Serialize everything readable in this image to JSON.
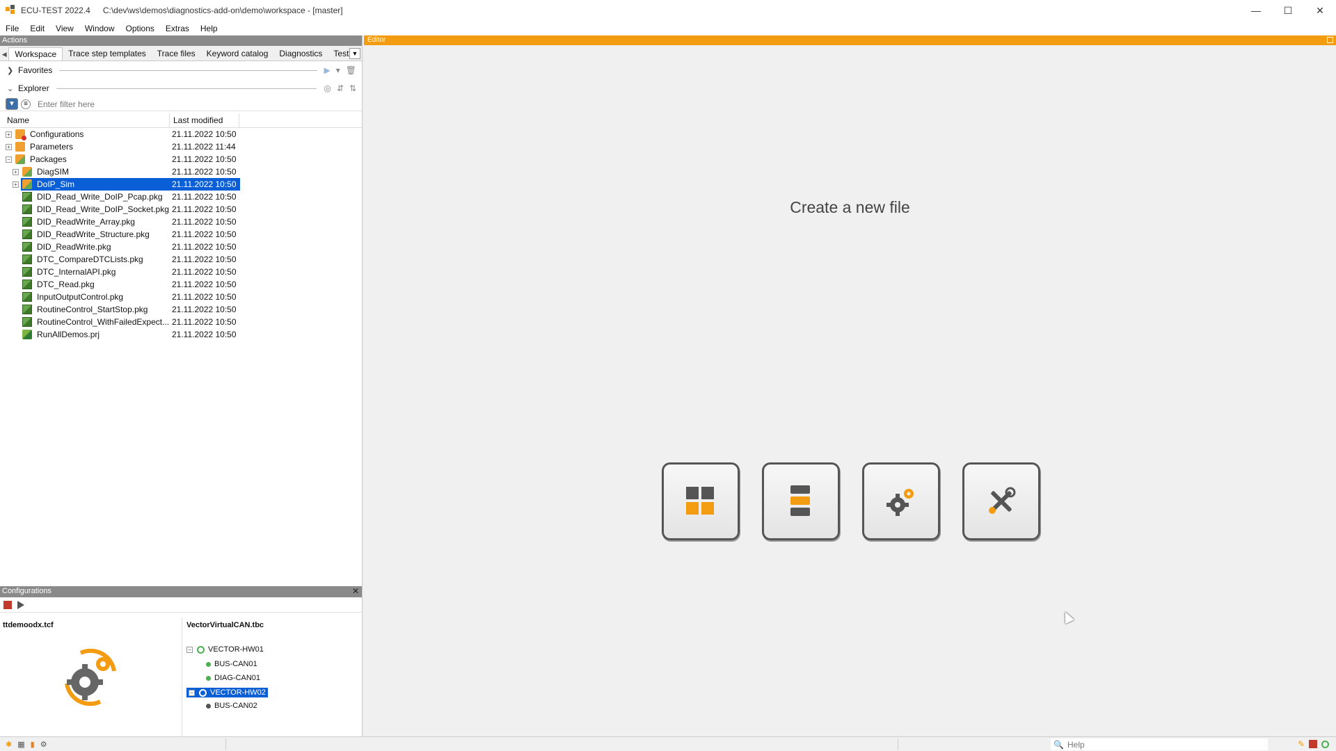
{
  "window": {
    "app_name": "ECU-TEST 2022.4",
    "path": "C:\\dev\\ws\\demos\\diagnostics-add-on\\demo\\workspace - [master]",
    "minimize": "—",
    "maximize": "☐",
    "close": "✕"
  },
  "menu": [
    "File",
    "Edit",
    "View",
    "Window",
    "Options",
    "Extras",
    "Help"
  ],
  "actions": {
    "header": "Actions",
    "tabs": [
      "Workspace",
      "Trace step templates",
      "Trace files",
      "Keyword catalog",
      "Diagnostics",
      "Test st"
    ],
    "favorites_label": "Favorites",
    "explorer_label": "Explorer",
    "filter_placeholder": "Enter filter here",
    "columns": {
      "name": "Name",
      "modified": "Last modified"
    },
    "rows": [
      {
        "name": "Configurations",
        "date": "21.11.2022 10:50",
        "level": 0,
        "expand": "+",
        "icon": "folder-red-icon"
      },
      {
        "name": "Parameters",
        "date": "21.11.2022 11:44",
        "level": 0,
        "expand": "+",
        "icon": "folder-icon"
      },
      {
        "name": "Packages",
        "date": "21.11.2022 10:50",
        "level": 0,
        "expand": "-",
        "icon": "packages-folder-icon"
      },
      {
        "name": "DiagSIM",
        "date": "21.11.2022 10:50",
        "level": 1,
        "expand": "+",
        "icon": "folder-icon"
      },
      {
        "name": "DoIP_Sim",
        "date": "21.11.2022 10:50",
        "level": 1,
        "expand": "+",
        "icon": "folder-icon",
        "selected": true
      },
      {
        "name": "DID_Read_Write_DoIP_Pcap.pkg",
        "date": "21.11.2022 10:50",
        "level": 1,
        "icon": "package-icon"
      },
      {
        "name": "DID_Read_Write_DoIP_Socket.pkg",
        "date": "21.11.2022 10:50",
        "level": 1,
        "icon": "package-icon"
      },
      {
        "name": "DID_ReadWrite_Array.pkg",
        "date": "21.11.2022 10:50",
        "level": 1,
        "icon": "package-icon"
      },
      {
        "name": "DID_ReadWrite_Structure.pkg",
        "date": "21.11.2022 10:50",
        "level": 1,
        "icon": "package-icon"
      },
      {
        "name": "DID_ReadWrite.pkg",
        "date": "21.11.2022 10:50",
        "level": 1,
        "icon": "package-icon"
      },
      {
        "name": "DTC_CompareDTCLists.pkg",
        "date": "21.11.2022 10:50",
        "level": 1,
        "icon": "package-icon"
      },
      {
        "name": "DTC_InternalAPI.pkg",
        "date": "21.11.2022 10:50",
        "level": 1,
        "icon": "package-icon"
      },
      {
        "name": "DTC_Read.pkg",
        "date": "21.11.2022 10:50",
        "level": 1,
        "icon": "package-icon"
      },
      {
        "name": "InputOutputControl.pkg",
        "date": "21.11.2022 10:50",
        "level": 1,
        "icon": "package-icon"
      },
      {
        "name": "RoutineControl_StartStop.pkg",
        "date": "21.11.2022 10:50",
        "level": 1,
        "icon": "package-icon"
      },
      {
        "name": "RoutineControl_WithFailedExpect...",
        "date": "21.11.2022 10:50",
        "level": 1,
        "icon": "package-icon"
      },
      {
        "name": "RunAllDemos.prj",
        "date": "21.11.2022 10:50",
        "level": 1,
        "icon": "project-icon"
      }
    ]
  },
  "configurations": {
    "header": "Configurations",
    "close": "✕",
    "tcf_name": "ttdemoodx.tcf",
    "tbc_name": "VectorVirtualCAN.tbc",
    "nodes": [
      {
        "label": "VECTOR-HW01",
        "kind": "hw"
      },
      {
        "label": "BUS-CAN01",
        "kind": "bus"
      },
      {
        "label": "DIAG-CAN01",
        "kind": "bus"
      },
      {
        "label": "VECTOR-HW02",
        "kind": "hw",
        "selected": true
      },
      {
        "label": "BUS-CAN02",
        "kind": "bus"
      }
    ]
  },
  "editor": {
    "header": "Editor",
    "create_title": "Create a new file",
    "tiles": [
      "new-package-tile",
      "new-project-tile",
      "new-config-tile",
      "new-tool-tile"
    ]
  },
  "statusbar": {
    "help_placeholder": "Help"
  },
  "colors": {
    "accent": "#f39c12",
    "selection": "#0b5fd6",
    "status_ok": "#4caf50"
  }
}
